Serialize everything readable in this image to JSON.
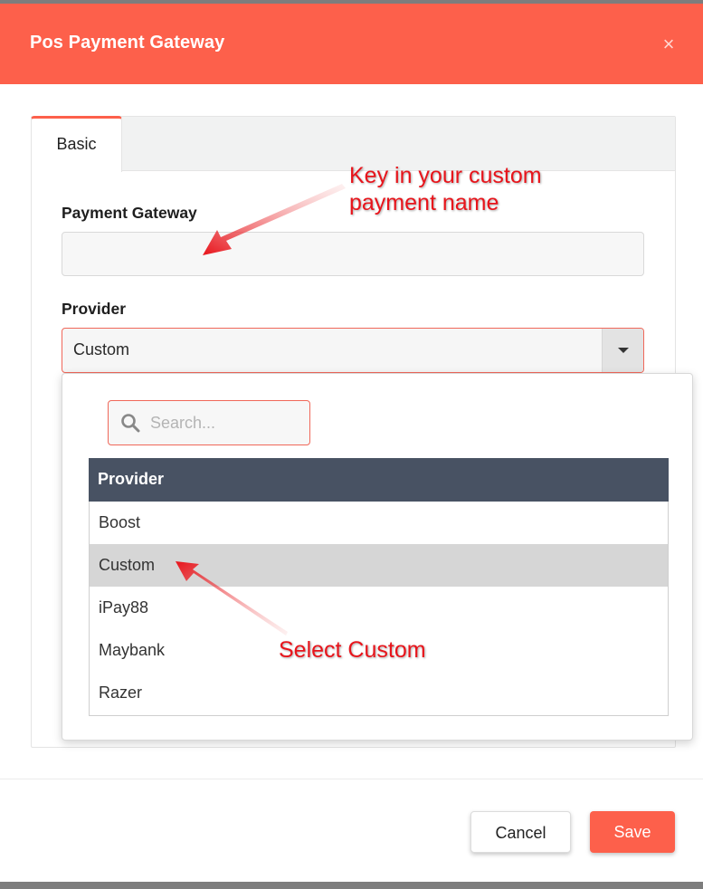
{
  "dialog": {
    "title": "Pos Payment Gateway",
    "close_glyph": "×"
  },
  "tabs": [
    {
      "label": "Basic",
      "active": true
    }
  ],
  "form": {
    "payment_gateway": {
      "label": "Payment Gateway",
      "value": ""
    },
    "provider": {
      "label": "Provider",
      "value": "Custom"
    }
  },
  "dropdown": {
    "search_placeholder": "Search...",
    "header": "Provider",
    "options": [
      "Boost",
      "Custom",
      "iPay88",
      "Maybank",
      "Razer"
    ],
    "selected": "Custom"
  },
  "buttons": {
    "cancel": "Cancel",
    "save": "Save"
  },
  "annotations": {
    "name_hint_line1": "Key in your custom",
    "name_hint_line2": "payment name",
    "select_hint": "Select Custom"
  },
  "colors": {
    "brand": "#fd604b",
    "grid_header": "#485263",
    "annotation": "#e8141b"
  },
  "icons": [
    "close-icon",
    "chevron-down-icon",
    "search-icon"
  ]
}
